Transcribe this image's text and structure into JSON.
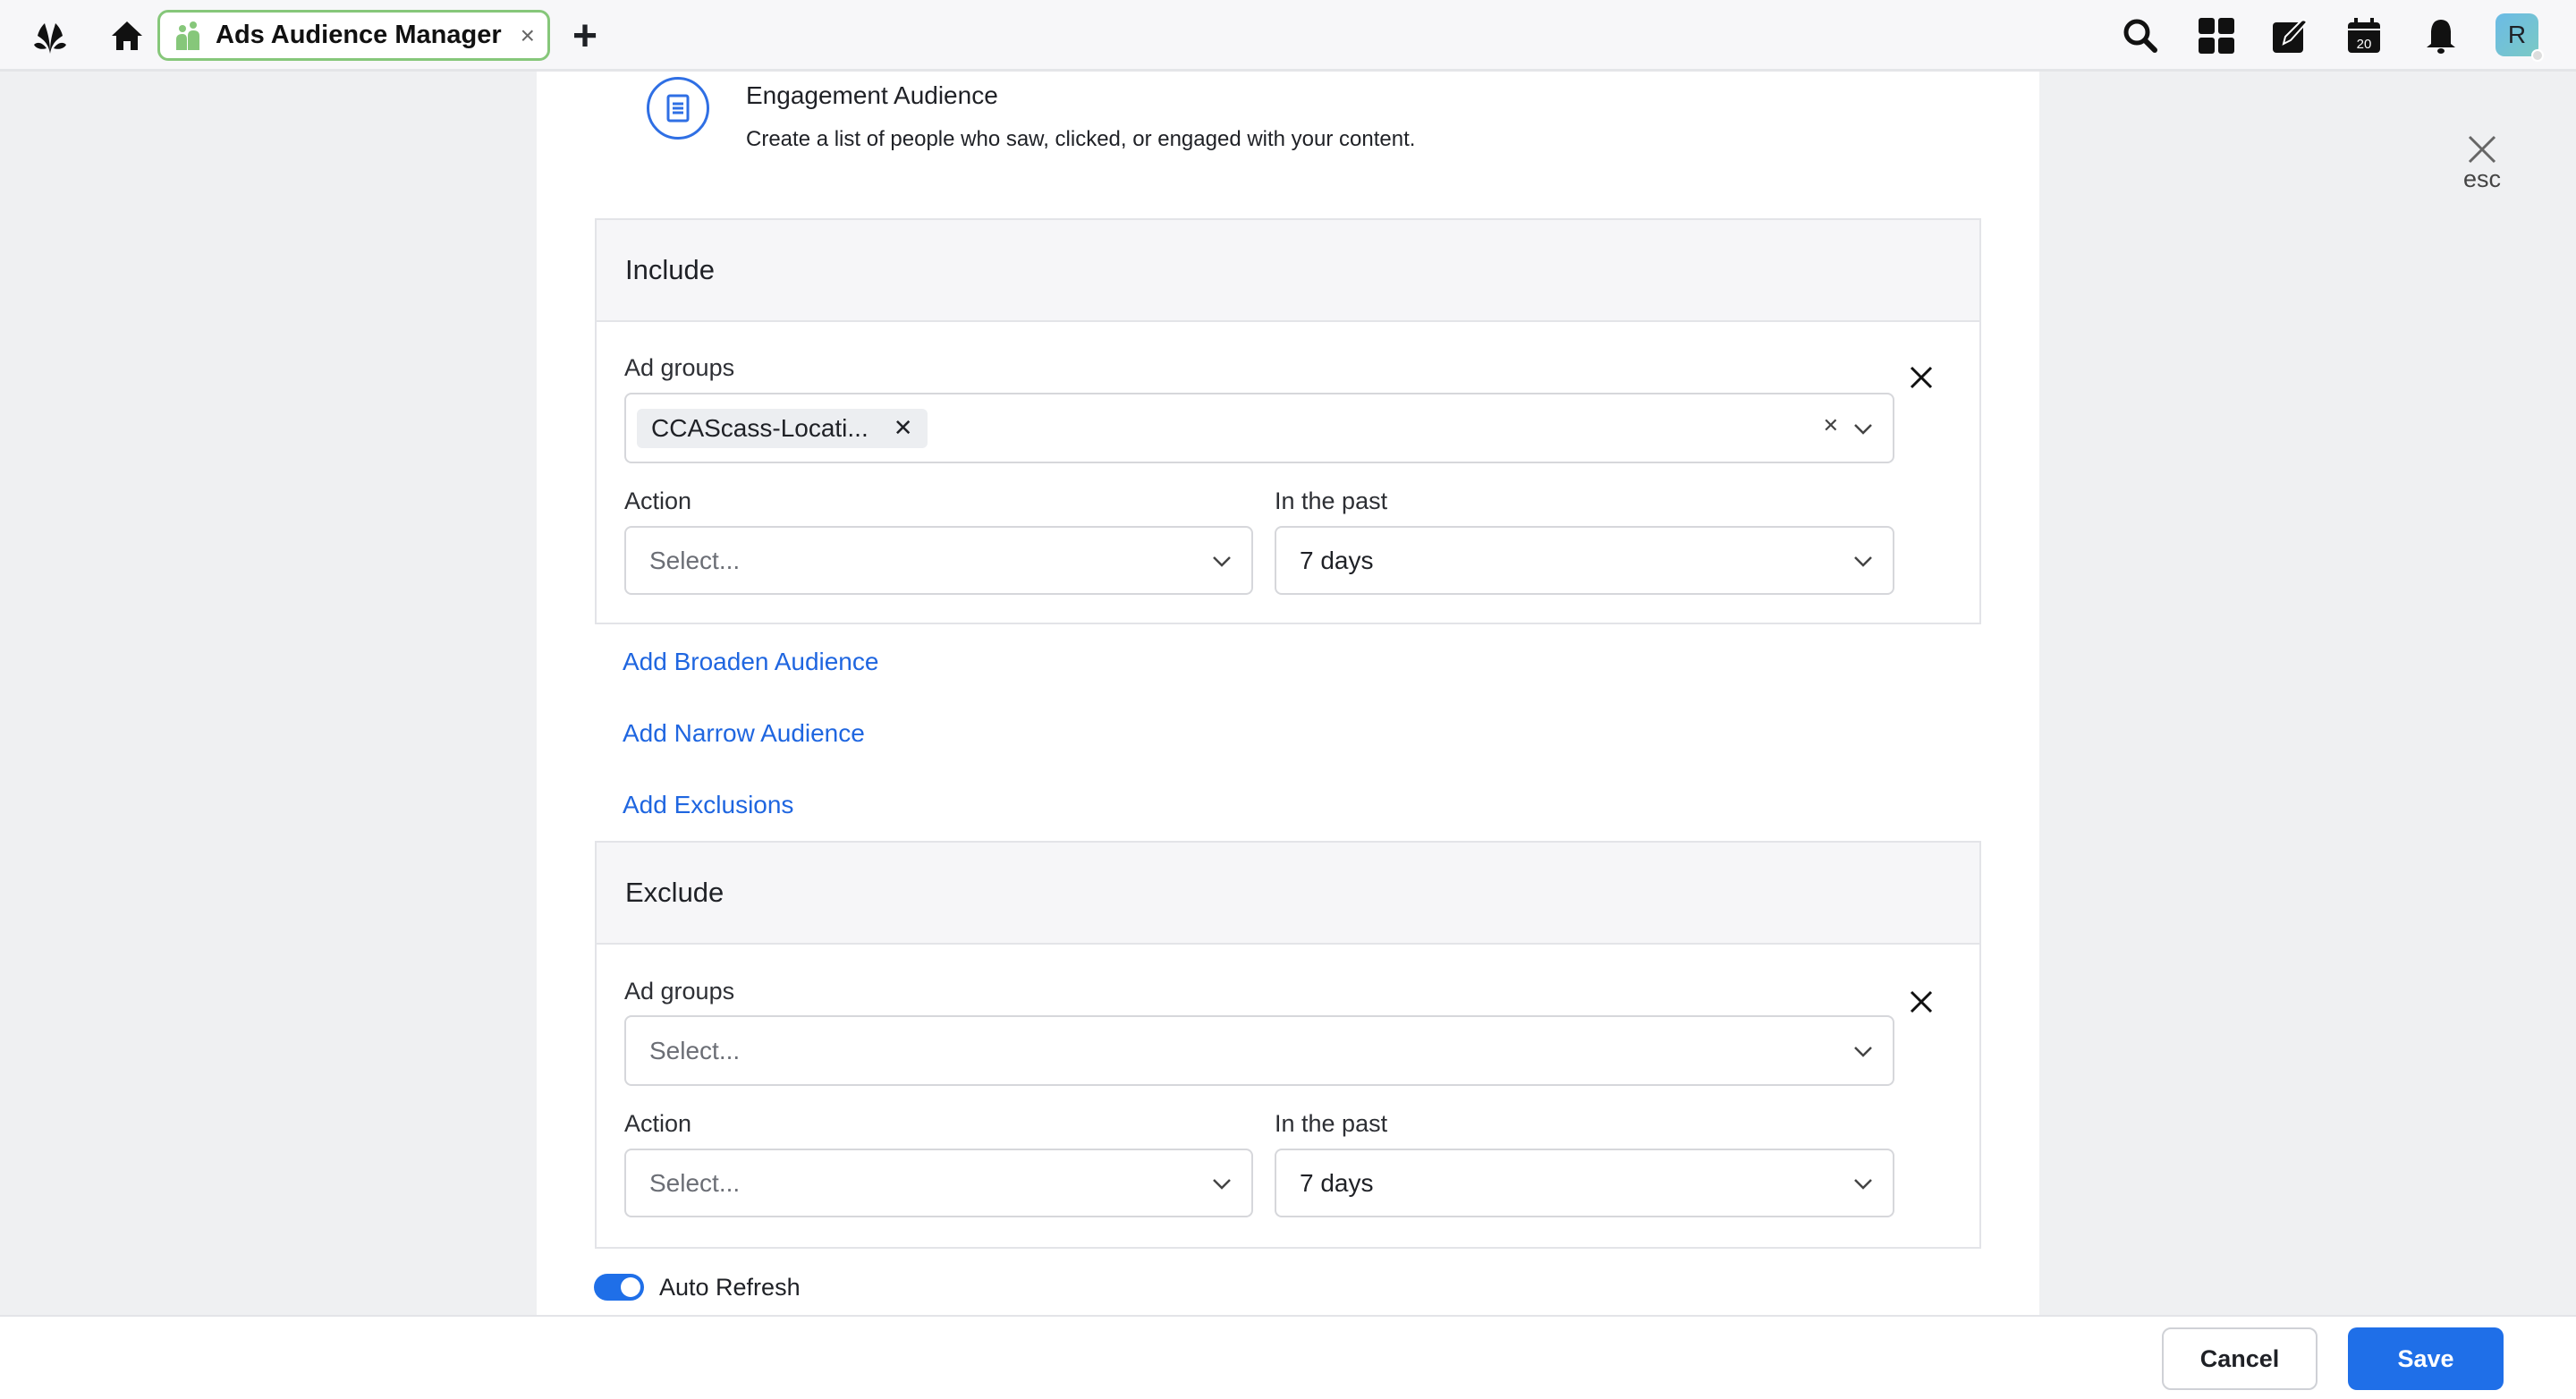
{
  "topbar": {
    "tab_title": "Ads Audience Manager",
    "tab_close": "×",
    "new_tab": "+",
    "calendar_day": "20",
    "avatar_initial": "R",
    "icons": [
      "logo-icon",
      "home-icon",
      "audience-icon",
      "search-icon",
      "grid-icon",
      "edit-icon",
      "calendar-icon",
      "bell-icon"
    ]
  },
  "header": {
    "title": "Engagement Audience",
    "description": "Create a list of people who saw, clicked, or engaged with your content.",
    "esc": "esc"
  },
  "include": {
    "title": "Include",
    "ad_groups_label": "Ad groups",
    "ad_group_chip": "CCAScass-Locati...",
    "action_label": "Action",
    "action_placeholder": "Select...",
    "past_label": "In the past",
    "past_value": "7 days"
  },
  "links": {
    "broaden": "Add Broaden Audience",
    "narrow": "Add Narrow Audience",
    "exclusions": "Add Exclusions"
  },
  "exclude": {
    "title": "Exclude",
    "ad_groups_label": "Ad groups",
    "ad_groups_placeholder": "Select...",
    "action_label": "Action",
    "action_placeholder": "Select...",
    "past_label": "In the past",
    "past_value": "7 days"
  },
  "auto_refresh": {
    "label": "Auto Refresh",
    "enabled": true
  },
  "footer": {
    "cancel": "Cancel",
    "save": "Save"
  },
  "colors": {
    "accent": "#1f6fe8",
    "tab_border": "#86c77a"
  }
}
